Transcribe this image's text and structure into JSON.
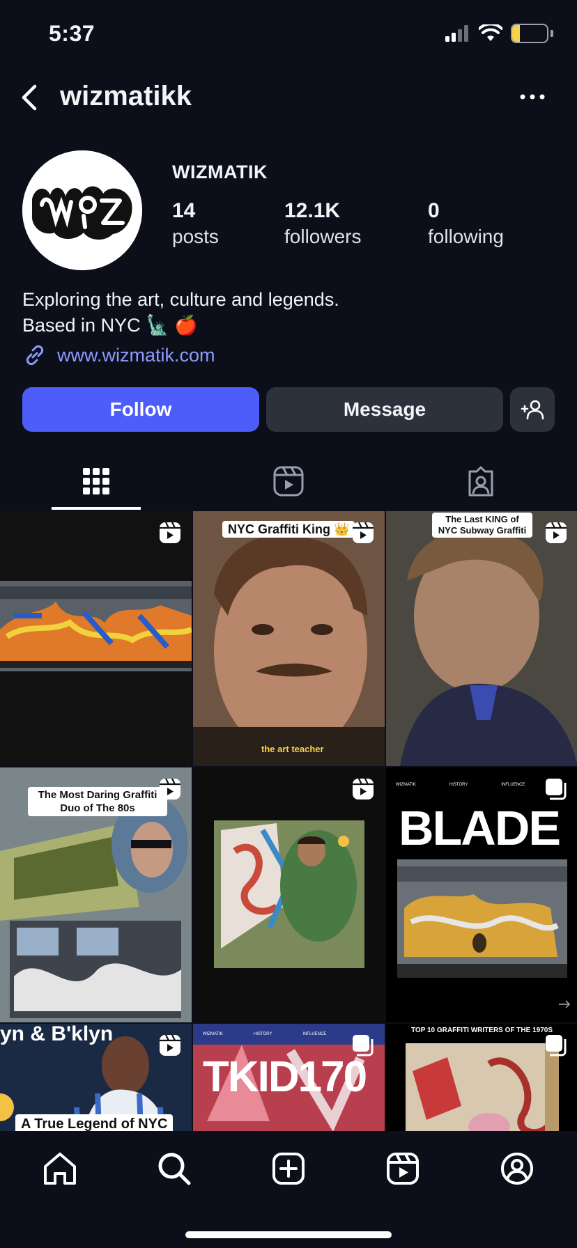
{
  "status_bar": {
    "time": "5:37",
    "battery": "10"
  },
  "header": {
    "username": "wizmatikk"
  },
  "profile": {
    "display_name": "WIZMATIK",
    "stats": [
      {
        "num": "14",
        "label": "posts"
      },
      {
        "num": "12.1K",
        "label": "followers"
      },
      {
        "num": "0",
        "label": "following"
      }
    ],
    "bio_line1": "Exploring the art, culture and legends.",
    "bio_line2": "Based in NYC 🗽 🍎",
    "link": "www.wizmatik.com"
  },
  "actions": {
    "follow": "Follow",
    "message": "Message"
  },
  "tabs": [
    "grid",
    "reels",
    "tagged"
  ],
  "grid": {
    "posts": [
      {
        "type": "reel",
        "caption": "",
        "bg": "#1a1a1a"
      },
      {
        "type": "reel",
        "caption": "NYC Graffiti King 👑",
        "subcaption": "the art teacher",
        "bg": "#8a6a52"
      },
      {
        "type": "reel",
        "caption": "The Last KING of NYC Subway Graffiti",
        "bg": "#5c5a52"
      },
      {
        "type": "reel",
        "caption": "The Most Daring Graffiti Duo of The 80s",
        "bg": "#5e6e74"
      },
      {
        "type": "reel",
        "caption": "",
        "bg": "#0d0d0d"
      },
      {
        "type": "carousel",
        "caption": "BLADE",
        "small_labels": [
          "WIZMATIK",
          "HISTORY",
          "INFLUENCE"
        ],
        "bg": "#000000"
      },
      {
        "type": "reel",
        "caption": "A True Legend of NYC",
        "top_text": "yn & B'klyn",
        "bg": "#1b2a44"
      },
      {
        "type": "carousel",
        "caption": "TKID170",
        "small_labels": [
          "WIZMATIK",
          "HISTORY",
          "INFLUENCE"
        ],
        "bg": "#c84a5a"
      },
      {
        "type": "carousel",
        "caption": "TOP 10 GRAFFITI WRITERS OF THE 1970S",
        "bg": "#d8c8b0"
      }
    ]
  }
}
